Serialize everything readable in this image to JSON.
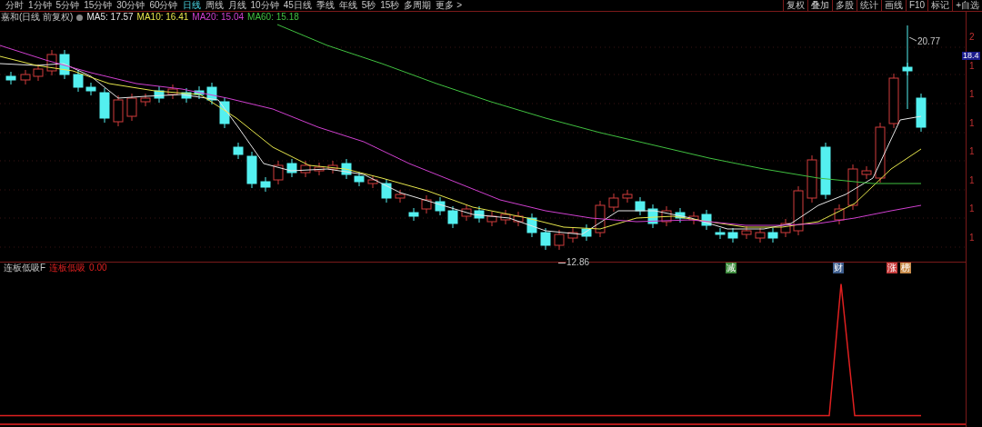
{
  "timeframe_tabs": [
    {
      "label": "分时",
      "selected": false
    },
    {
      "label": "1分钟",
      "selected": false
    },
    {
      "label": "5分钟",
      "selected": false
    },
    {
      "label": "15分钟",
      "selected": false
    },
    {
      "label": "30分钟",
      "selected": false
    },
    {
      "label": "60分钟",
      "selected": false
    },
    {
      "label": "日线",
      "selected": true
    },
    {
      "label": "周线",
      "selected": false
    },
    {
      "label": "月线",
      "selected": false
    },
    {
      "label": "10分钟",
      "selected": false
    },
    {
      "label": "45日线",
      "selected": false
    },
    {
      "label": "季线",
      "selected": false
    },
    {
      "label": "年线",
      "selected": false
    },
    {
      "label": "5秒",
      "selected": false
    },
    {
      "label": "15秒",
      "selected": false
    },
    {
      "label": "多周期",
      "selected": false
    },
    {
      "label": "更多 >",
      "selected": false
    }
  ],
  "toolbar_buttons": [
    "复权",
    "叠加",
    "多股",
    "统计",
    "画线",
    "F10",
    "标记",
    "+自选"
  ],
  "legend": {
    "title": "嘉和(日线 前复权)",
    "averages": [
      {
        "label": "MA5: 17.57",
        "color": "#e6e6e6"
      },
      {
        "label": "MA10: 16.41",
        "color": "#e6e64c"
      },
      {
        "label": "MA20: 15.04",
        "color": "#d040d0"
      },
      {
        "label": "MA60: 15.18",
        "color": "#40c040"
      }
    ]
  },
  "price_labels": {
    "high": "20.77",
    "low": "12.86"
  },
  "signal_tags": [
    {
      "label": "减",
      "color": "#3c8c3c"
    },
    {
      "label": "财",
      "color": "#3c5c8c"
    },
    {
      "label": "涨",
      "color": "#c83c3c"
    },
    {
      "label": "榜",
      "color": "#c88c4c"
    }
  ],
  "axis": {
    "ticks": [
      "2",
      "1",
      "1",
      "1",
      "1",
      "1",
      "1",
      "1"
    ],
    "current_price": "18.4"
  },
  "indicator": {
    "name": "连板低吸F",
    "series_label": "连板低吸",
    "value": "0.00"
  }
}
